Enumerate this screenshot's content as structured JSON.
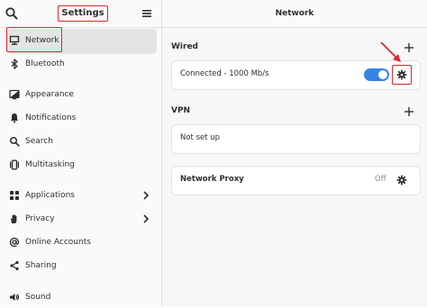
{
  "sidebar": {
    "title": "Settings",
    "items": [
      {
        "label": "Network",
        "icon": "network-wired-icon",
        "selected": true
      },
      {
        "label": "Bluetooth",
        "icon": "bluetooth-icon"
      },
      {
        "label": "Appearance",
        "icon": "appearance-icon"
      },
      {
        "label": "Notifications",
        "icon": "bell-icon"
      },
      {
        "label": "Search",
        "icon": "search-icon"
      },
      {
        "label": "Multitasking",
        "icon": "multitasking-icon"
      },
      {
        "label": "Applications",
        "icon": "applications-grid-icon",
        "chevron": true
      },
      {
        "label": "Privacy",
        "icon": "hand-icon",
        "chevron": true
      },
      {
        "label": "Online Accounts",
        "icon": "at-icon"
      },
      {
        "label": "Sharing",
        "icon": "share-icon"
      },
      {
        "label": "Sound",
        "icon": "speaker-icon"
      }
    ]
  },
  "main": {
    "title": "Network",
    "wired": {
      "title": "Wired",
      "status": "Connected - 1000 Mb/s",
      "toggle_on": true
    },
    "vpn": {
      "title": "VPN",
      "status": "Not set up"
    },
    "proxy": {
      "label": "Network Proxy",
      "status": "Off"
    }
  },
  "colors": {
    "accent": "#3584e4",
    "highlight": "#e0242a"
  }
}
